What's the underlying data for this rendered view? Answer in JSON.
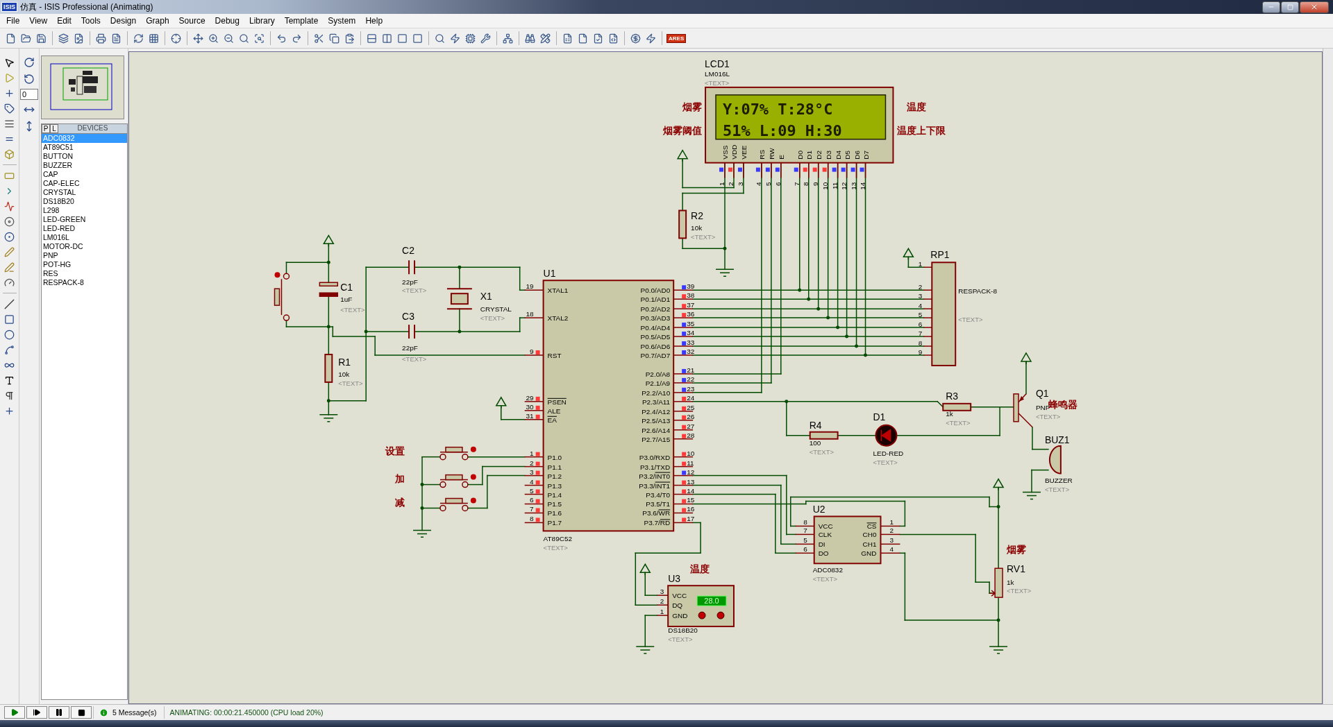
{
  "window": {
    "app_icon": "ISIS",
    "title": "仿真 - ISIS Professional (Animating)"
  },
  "menu": [
    "File",
    "View",
    "Edit",
    "Tools",
    "Design",
    "Graph",
    "Source",
    "Debug",
    "Library",
    "Template",
    "System",
    "Help"
  ],
  "toolbar": {
    "badge": "ARES"
  },
  "rotation_field": {
    "value": "0"
  },
  "device_panel": {
    "tabs": [
      {
        "label": "P"
      },
      {
        "label": "L"
      }
    ],
    "header": "DEVICES",
    "items": [
      {
        "label": "ADC0832",
        "selected": true
      },
      {
        "label": "AT89C51",
        "selected": false
      },
      {
        "label": "BUTTON",
        "selected": false
      },
      {
        "label": "BUZZER",
        "selected": false
      },
      {
        "label": "CAP",
        "selected": false
      },
      {
        "label": "CAP-ELEC",
        "selected": false
      },
      {
        "label": "CRYSTAL",
        "selected": false
      },
      {
        "label": "DS18B20",
        "selected": false
      },
      {
        "label": "L298",
        "selected": false
      },
      {
        "label": "LED-GREEN",
        "selected": false
      },
      {
        "label": "LED-RED",
        "selected": false
      },
      {
        "label": "LM016L",
        "selected": false
      },
      {
        "label": "MOTOR-DC",
        "selected": false
      },
      {
        "label": "PNP",
        "selected": false
      },
      {
        "label": "POT-HG",
        "selected": false
      },
      {
        "label": "RES",
        "selected": false
      },
      {
        "label": "RESPACK-8",
        "selected": false
      }
    ]
  },
  "schematic": {
    "parts": [
      {
        "kind": "lcd",
        "ref": "LCD1",
        "value": "LM016L",
        "text": "<TEXT>",
        "lines": [
          "Y:07% T:28°C",
          "51% L:09 H:30"
        ],
        "pins": [
          {
            "name": "VSS",
            "number": "1",
            "high": false
          },
          {
            "name": "VDD",
            "number": "2",
            "high": true
          },
          {
            "name": "VEE",
            "number": "3",
            "high": false
          },
          {
            "name": "RS",
            "number": "4",
            "high": false
          },
          {
            "name": "RW",
            "number": "5",
            "high": false
          },
          {
            "name": "E",
            "number": "6",
            "high": false
          },
          {
            "name": "D0",
            "number": "7",
            "high": false
          },
          {
            "name": "D1",
            "number": "8",
            "high": true
          },
          {
            "name": "D2",
            "number": "9",
            "high": true
          },
          {
            "name": "D3",
            "number": "10",
            "high": true
          },
          {
            "name": "D4",
            "number": "11",
            "high": false
          },
          {
            "name": "D5",
            "number": "12",
            "high": false
          },
          {
            "name": "D6",
            "number": "13",
            "high": false
          },
          {
            "name": "D7",
            "number": "14",
            "high": false
          }
        ]
      },
      {
        "kind": "mcu",
        "ref": "U1",
        "value": "AT89C52",
        "text": "<TEXT>",
        "pins_left": [
          {
            "name": "XTAL1",
            "number": "19"
          },
          {
            "name": "XTAL2",
            "number": "18"
          },
          {
            "name": "RST",
            "number": "9",
            "high": true
          },
          {
            "name": "PSEN",
            "number": "29",
            "high": true,
            "overline": true
          },
          {
            "name": "ALE",
            "number": "30",
            "high": true
          },
          {
            "name": "EA",
            "number": "31",
            "high": true,
            "overline": true
          },
          {
            "name": "P1.0",
            "number": "1",
            "high": true
          },
          {
            "name": "P1.1",
            "number": "2",
            "high": true
          },
          {
            "name": "P1.2",
            "number": "3",
            "high": true
          },
          {
            "name": "P1.3",
            "number": "4",
            "high": true
          },
          {
            "name": "P1.4",
            "number": "5",
            "high": true
          },
          {
            "name": "P1.5",
            "number": "6",
            "high": true
          },
          {
            "name": "P1.6",
            "number": "7",
            "high": true
          },
          {
            "name": "P1.7",
            "number": "8",
            "high": true
          }
        ],
        "pins_right": [
          {
            "name": "P0.0/AD0",
            "number": "39",
            "high": false
          },
          {
            "name": "P0.1/AD1",
            "number": "38",
            "high": true
          },
          {
            "name": "P0.2/AD2",
            "number": "37",
            "high": true
          },
          {
            "name": "P0.3/AD3",
            "number": "36",
            "high": true
          },
          {
            "name": "P0.4/AD4",
            "number": "35",
            "high": false
          },
          {
            "name": "P0.5/AD5",
            "number": "34",
            "high": false
          },
          {
            "name": "P0.6/AD6",
            "number": "33",
            "high": false
          },
          {
            "name": "P0.7/AD7",
            "number": "32",
            "high": false
          },
          {
            "name": "P2.0/A8",
            "number": "21",
            "high": false
          },
          {
            "name": "P2.1/A9",
            "number": "22",
            "high": false
          },
          {
            "name": "P2.2/A10",
            "number": "23",
            "high": false
          },
          {
            "name": "P2.3/A11",
            "number": "24",
            "high": true
          },
          {
            "name": "P2.4/A12",
            "number": "25",
            "high": true
          },
          {
            "name": "P2.5/A13",
            "number": "26",
            "high": true
          },
          {
            "name": "P2.6/A14",
            "number": "27",
            "high": true
          },
          {
            "name": "P2.7/A15",
            "number": "28",
            "high": true
          },
          {
            "name": "P3.0/RXD",
            "number": "10",
            "high": true
          },
          {
            "name": "P3.1/TXD",
            "number": "11",
            "high": true
          },
          {
            "name": "P3.2/",
            "alt": "INT0",
            "number": "12",
            "high": false,
            "overline": true
          },
          {
            "name": "P3.3/",
            "alt": "INT1",
            "number": "13",
            "high": true,
            "overline": true
          },
          {
            "name": "P3.4/T0",
            "number": "14",
            "high": true
          },
          {
            "name": "P3.5/T1",
            "number": "15",
            "high": true
          },
          {
            "name": "P3.6/",
            "alt": "WR",
            "number": "16",
            "high": true,
            "overline": true
          },
          {
            "name": "P3.7/",
            "alt": "RD",
            "number": "17",
            "high": true,
            "overline": true
          }
        ]
      },
      {
        "kind": "respack",
        "ref": "RP1",
        "value": "RESPACK-8",
        "text": "<TEXT>",
        "pins": [
          "1",
          "2",
          "3",
          "4",
          "5",
          "6",
          "7",
          "8",
          "9"
        ]
      },
      {
        "kind": "resistor",
        "ref": "R2",
        "value": "10k",
        "text": "<TEXT>"
      },
      {
        "kind": "cap_elec",
        "ref": "C1",
        "value": "1uF",
        "text": "<TEXT>"
      },
      {
        "kind": "resistor",
        "ref": "R1",
        "value": "10k",
        "text": "<TEXT>"
      },
      {
        "kind": "capacitor",
        "ref": "C2",
        "value": "22pF",
        "text": "<TEXT>"
      },
      {
        "kind": "capacitor",
        "ref": "C3",
        "value": "22pF",
        "text": "<TEXT>"
      },
      {
        "kind": "crystal",
        "ref": "X1",
        "value": "CRYSTAL",
        "text": "<TEXT>"
      },
      {
        "kind": "button"
      },
      {
        "kind": "button"
      },
      {
        "kind": "button"
      },
      {
        "kind": "button"
      },
      {
        "kind": "adc",
        "ref": "U2",
        "value": "ADC0832",
        "text": "<TEXT>",
        "pins_left": [
          {
            "name": "VCC",
            "number": "8"
          },
          {
            "name": "CLK",
            "number": "7"
          },
          {
            "name": "DI",
            "number": "5"
          },
          {
            "name": "DO",
            "number": "6"
          }
        ],
        "pins_right": [
          {
            "name": "CS",
            "number": "1",
            "overline": true
          },
          {
            "name": "CH0",
            "number": "2"
          },
          {
            "name": "CH1",
            "number": "3"
          },
          {
            "name": "GND",
            "number": "4"
          }
        ]
      },
      {
        "kind": "sensor",
        "ref": "U3",
        "value": "DS18B20",
        "text": "<TEXT>",
        "reading": "28.0",
        "pins": [
          {
            "name": "VCC",
            "number": "3"
          },
          {
            "name": "DQ",
            "number": "2"
          },
          {
            "name": "GND",
            "number": "1"
          }
        ]
      },
      {
        "kind": "resistor",
        "ref": "R3",
        "value": "1k",
        "text": "<TEXT>"
      },
      {
        "kind": "resistor",
        "ref": "R4",
        "value": "100",
        "text": "<TEXT>"
      },
      {
        "kind": "led",
        "ref": "D1",
        "value": "LED-RED",
        "text": "<TEXT>"
      },
      {
        "kind": "transistor",
        "ref": "Q1",
        "value": "PNP",
        "text": "<TEXT>"
      },
      {
        "kind": "buzzer",
        "ref": "BUZ1",
        "value": "BUZZER",
        "text": "<TEXT>"
      },
      {
        "kind": "pot",
        "ref": "RV1",
        "value": "1k",
        "text": "<TEXT>"
      }
    ],
    "annotations": [
      "烟雾",
      "烟雾阈值",
      "温度",
      "温度上下限",
      "设置",
      "加",
      "减",
      "蜂鸣器",
      "温度",
      "烟雾"
    ]
  },
  "status_bar": {
    "messages": "5 Message(s)",
    "simulation": "ANIMATING: 00:00:21.450000 (CPU load 20%)"
  }
}
